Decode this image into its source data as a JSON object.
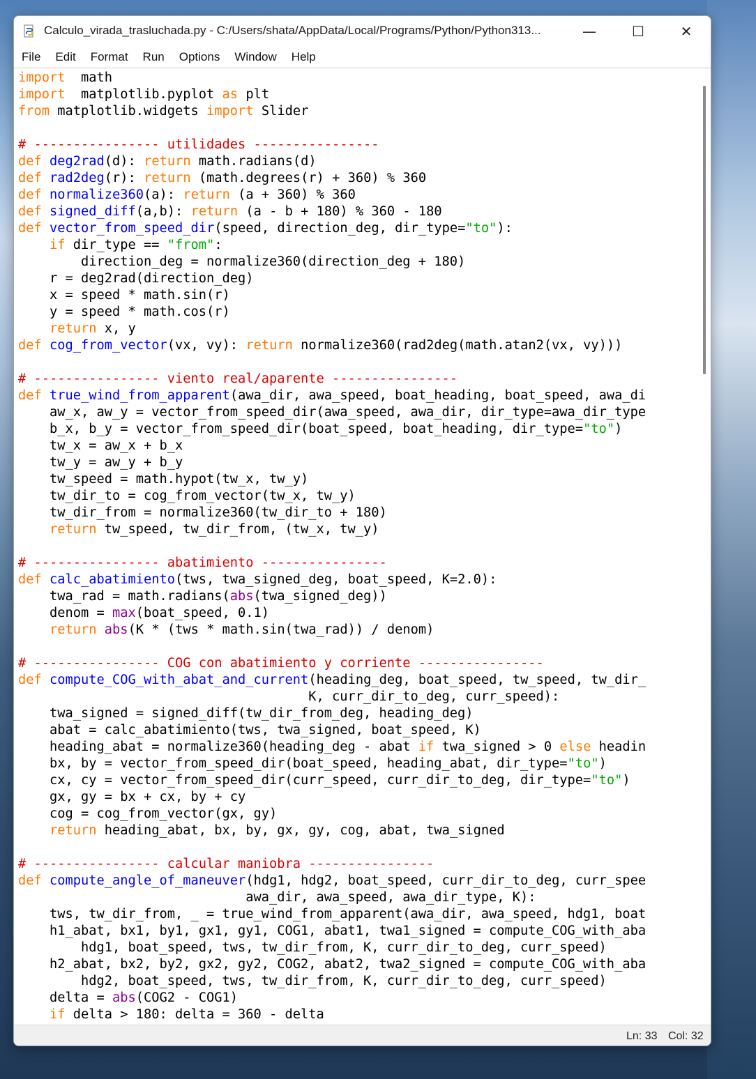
{
  "window": {
    "title": "Calculo_virada_trasluchada.py - C:/Users/shata/AppData/Local/Programs/Python/Python313...",
    "minimize_symbol": "—",
    "maximize_symbol": "☐",
    "close_symbol": "✕"
  },
  "menu": [
    "File",
    "Edit",
    "Format",
    "Run",
    "Options",
    "Window",
    "Help"
  ],
  "status": {
    "line": "Ln: 33",
    "col": "Col: 32"
  },
  "colors": {
    "keyword": "#ff7700",
    "builtin": "#900090",
    "definition": "#0000ff",
    "string": "#00aa00",
    "comment": "#dd0000"
  },
  "code_lines": [
    [
      [
        "kw",
        "import"
      ],
      [
        "",
        "  math"
      ]
    ],
    [
      [
        "kw",
        "import"
      ],
      [
        "",
        "  matplotlib.pyplot "
      ],
      [
        "kw",
        "as"
      ],
      [
        "",
        " plt"
      ]
    ],
    [
      [
        "kw",
        "from"
      ],
      [
        "",
        " matplotlib.widgets "
      ],
      [
        "kw",
        "import"
      ],
      [
        "",
        " Slider"
      ]
    ],
    [],
    [
      [
        "cm",
        "# ---------------- utilidades ----------------"
      ]
    ],
    [
      [
        "kw",
        "def"
      ],
      [
        "",
        " "
      ],
      [
        "fn",
        "deg2rad"
      ],
      [
        "",
        "(d): "
      ],
      [
        "kw",
        "return"
      ],
      [
        "",
        " math.radians(d)"
      ]
    ],
    [
      [
        "kw",
        "def"
      ],
      [
        "",
        " "
      ],
      [
        "fn",
        "rad2deg"
      ],
      [
        "",
        "(r): "
      ],
      [
        "kw",
        "return"
      ],
      [
        "",
        " (math.degrees(r) + 360) % 360"
      ]
    ],
    [
      [
        "kw",
        "def"
      ],
      [
        "",
        " "
      ],
      [
        "fn",
        "normalize360"
      ],
      [
        "",
        "(a): "
      ],
      [
        "kw",
        "return"
      ],
      [
        "",
        " (a + 360) % 360"
      ]
    ],
    [
      [
        "kw",
        "def"
      ],
      [
        "",
        " "
      ],
      [
        "fn",
        "signed_diff"
      ],
      [
        "",
        "(a,b): "
      ],
      [
        "kw",
        "return"
      ],
      [
        "",
        " (a - b + 180) % 360 - 180"
      ]
    ],
    [
      [
        "kw",
        "def"
      ],
      [
        "",
        " "
      ],
      [
        "fn",
        "vector_from_speed_dir"
      ],
      [
        "",
        "(speed, direction_deg, dir_type="
      ],
      [
        "st",
        "\"to\""
      ],
      [
        "",
        "):"
      ]
    ],
    [
      [
        "",
        "    "
      ],
      [
        "kw",
        "if"
      ],
      [
        "",
        " dir_type == "
      ],
      [
        "st",
        "\"from\""
      ],
      [
        "",
        ":"
      ]
    ],
    [
      [
        "",
        "        direction_deg = normalize360(direction_deg + 180)"
      ]
    ],
    [
      [
        "",
        "    r = deg2rad(direction_deg)"
      ]
    ],
    [
      [
        "",
        "    x = speed * math.sin(r)"
      ]
    ],
    [
      [
        "",
        "    y = speed * math.cos(r)"
      ]
    ],
    [
      [
        "",
        "    "
      ],
      [
        "kw",
        "return"
      ],
      [
        "",
        " x, y"
      ]
    ],
    [
      [
        "kw",
        "def"
      ],
      [
        "",
        " "
      ],
      [
        "fn",
        "cog_from_vector"
      ],
      [
        "",
        "(vx, vy): "
      ],
      [
        "kw",
        "return"
      ],
      [
        "",
        " normalize360(rad2deg(math.atan2(vx, vy)))"
      ]
    ],
    [],
    [
      [
        "cm",
        "# ---------------- viento real/aparente ----------------"
      ]
    ],
    [
      [
        "kw",
        "def"
      ],
      [
        "",
        " "
      ],
      [
        "fn",
        "true_wind_from_apparent"
      ],
      [
        "",
        "(awa_dir, awa_speed, boat_heading, boat_speed, awa_di"
      ]
    ],
    [
      [
        "",
        "    aw_x, aw_y = vector_from_speed_dir(awa_speed, awa_dir, dir_type=awa_dir_type"
      ]
    ],
    [
      [
        "",
        "    b_x, b_y = vector_from_speed_dir(boat_speed, boat_heading, dir_type="
      ],
      [
        "st",
        "\"to\""
      ],
      [
        "",
        ")"
      ]
    ],
    [
      [
        "",
        "    tw_x = aw_x + b_x"
      ]
    ],
    [
      [
        "",
        "    tw_y = aw_y + b_y"
      ]
    ],
    [
      [
        "",
        "    tw_speed = math.hypot(tw_x, tw_y)"
      ]
    ],
    [
      [
        "",
        "    tw_dir_to = cog_from_vector(tw_x, tw_y)"
      ]
    ],
    [
      [
        "",
        "    tw_dir_from = normalize360(tw_dir_to + 180)"
      ]
    ],
    [
      [
        "",
        "    "
      ],
      [
        "kw",
        "return"
      ],
      [
        "",
        " tw_speed, tw_dir_from, (tw_x, tw_y)"
      ]
    ],
    [],
    [
      [
        "cm",
        "# ---------------- abatimiento ----------------"
      ]
    ],
    [
      [
        "kw",
        "def"
      ],
      [
        "",
        " "
      ],
      [
        "fn",
        "calc_abatimiento"
      ],
      [
        "",
        "(tws, twa_signed_deg, boat_speed, K=2.0):"
      ]
    ],
    [
      [
        "",
        "    twa_rad = math.radians("
      ],
      [
        "bi",
        "abs"
      ],
      [
        "",
        "(twa_signed_deg))"
      ]
    ],
    [
      [
        "",
        "    denom = "
      ],
      [
        "bi",
        "max"
      ],
      [
        "",
        "(boat_speed, 0.1)"
      ]
    ],
    [
      [
        "",
        "    "
      ],
      [
        "kw",
        "return"
      ],
      [
        "",
        " "
      ],
      [
        "bi",
        "abs"
      ],
      [
        "",
        "(K * (tws * math.sin(twa_rad)) / denom)"
      ]
    ],
    [],
    [
      [
        "cm",
        "# ---------------- COG con abatimiento y corriente ----------------"
      ]
    ],
    [
      [
        "kw",
        "def"
      ],
      [
        "",
        " "
      ],
      [
        "fn",
        "compute_COG_with_abat_and_current"
      ],
      [
        "",
        "(heading_deg, boat_speed, tw_speed, tw_dir_"
      ]
    ],
    [
      [
        "",
        "                                     K, curr_dir_to_deg, curr_speed):"
      ]
    ],
    [
      [
        "",
        "    twa_signed = signed_diff(tw_dir_from_deg, heading_deg)"
      ]
    ],
    [
      [
        "",
        "    abat = calc_abatimiento(tws, twa_signed, boat_speed, K)"
      ]
    ],
    [
      [
        "",
        "    heading_abat = normalize360(heading_deg - abat "
      ],
      [
        "kw",
        "if"
      ],
      [
        "",
        " twa_signed > 0 "
      ],
      [
        "kw",
        "else"
      ],
      [
        "",
        " headin"
      ]
    ],
    [
      [
        "",
        "    bx, by = vector_from_speed_dir(boat_speed, heading_abat, dir_type="
      ],
      [
        "st",
        "\"to\""
      ],
      [
        "",
        ")"
      ]
    ],
    [
      [
        "",
        "    cx, cy = vector_from_speed_dir(curr_speed, curr_dir_to_deg, dir_type="
      ],
      [
        "st",
        "\"to\""
      ],
      [
        "",
        ")"
      ]
    ],
    [
      [
        "",
        "    gx, gy = bx + cx, by + cy"
      ]
    ],
    [
      [
        "",
        "    cog = cog_from_vector(gx, gy)"
      ]
    ],
    [
      [
        "",
        "    "
      ],
      [
        "kw",
        "return"
      ],
      [
        "",
        " heading_abat, bx, by, gx, gy, cog, abat, twa_signed"
      ]
    ],
    [],
    [
      [
        "cm",
        "# ---------------- calcular maniobra ----------------"
      ]
    ],
    [
      [
        "kw",
        "def"
      ],
      [
        "",
        " "
      ],
      [
        "fn",
        "compute_angle_of_maneuver"
      ],
      [
        "",
        "(hdg1, hdg2, boat_speed, curr_dir_to_deg, curr_spee"
      ]
    ],
    [
      [
        "",
        "                             awa_dir, awa_speed, awa_dir_type, K):"
      ]
    ],
    [
      [
        "",
        "    tws, tw_dir_from, _ = true_wind_from_apparent(awa_dir, awa_speed, hdg1, boat"
      ]
    ],
    [
      [
        "",
        "    h1_abat, bx1, by1, gx1, gy1, COG1, abat1, twa1_signed = compute_COG_with_aba"
      ]
    ],
    [
      [
        "",
        "        hdg1, boat_speed, tws, tw_dir_from, K, curr_dir_to_deg, curr_speed)"
      ]
    ],
    [
      [
        "",
        "    h2_abat, bx2, by2, gx2, gy2, COG2, abat2, twa2_signed = compute_COG_with_aba"
      ]
    ],
    [
      [
        "",
        "        hdg2, boat_speed, tws, tw_dir_from, K, curr_dir_to_deg, curr_speed)"
      ]
    ],
    [
      [
        "",
        "    delta = "
      ],
      [
        "bi",
        "abs"
      ],
      [
        "",
        "(COG2 - COG1)"
      ]
    ],
    [
      [
        "",
        "    "
      ],
      [
        "kw",
        "if"
      ],
      [
        "",
        " delta > 180: delta = 360 - delta"
      ]
    ]
  ]
}
